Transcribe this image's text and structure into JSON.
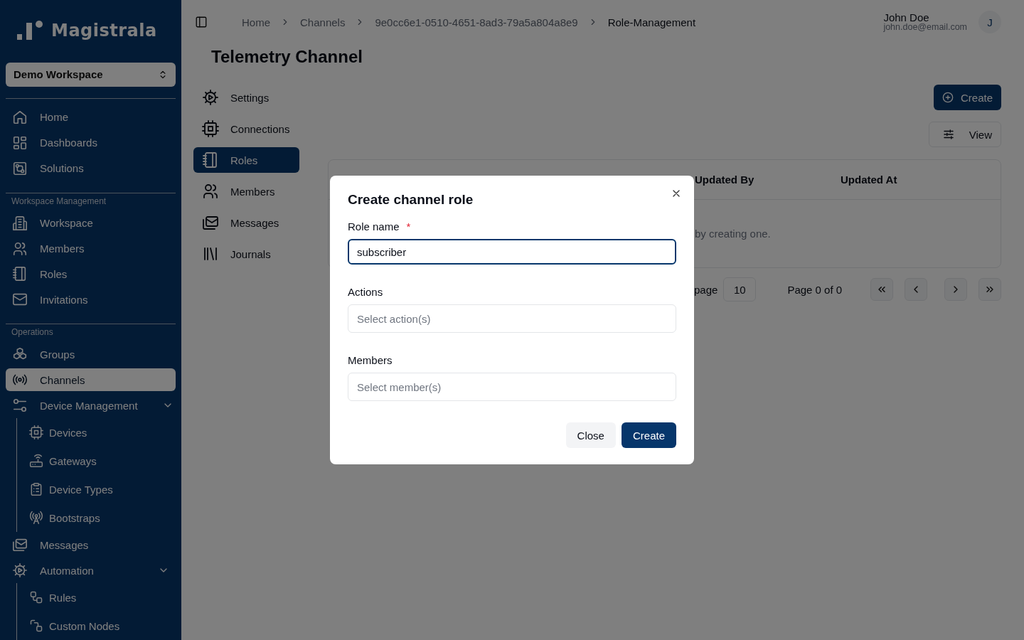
{
  "sidebar": {
    "logo": "Magistrala",
    "workspace": "Demo Workspace",
    "sections": [
      {
        "items": [
          {
            "label": "Home",
            "selected": false
          },
          {
            "label": "Dashboards",
            "selected": false
          },
          {
            "label": "Solutions",
            "selected": false
          }
        ]
      },
      {
        "heading": "Workspace Management",
        "items": [
          {
            "label": "Workspace",
            "selected": false
          },
          {
            "label": "Members",
            "selected": false
          },
          {
            "label": "Roles",
            "selected": false
          },
          {
            "label": "Invitations",
            "selected": false
          }
        ]
      },
      {
        "heading": "Operations",
        "items": [
          {
            "label": "Groups",
            "selected": false
          },
          {
            "label": "Channels",
            "selected": true
          },
          {
            "label": "Device Management",
            "selected": false,
            "expanded": true,
            "children": [
              {
                "label": "Devices",
                "selected": false
              },
              {
                "label": "Gateways",
                "selected": false
              },
              {
                "label": "Device Types",
                "selected": false
              },
              {
                "label": "Bootstraps",
                "selected": false
              }
            ]
          },
          {
            "label": "Messages",
            "selected": false
          },
          {
            "label": "Automation",
            "selected": false,
            "expanded": true,
            "children": [
              {
                "label": "Rules",
                "selected": false
              },
              {
                "label": "Custom Nodes",
                "selected": false
              }
            ]
          }
        ]
      }
    ]
  },
  "breadcrumbs": [
    "Home",
    "Channels",
    "9e0cc6e1-0510-4651-8ad3-79a5a804a8e9",
    "Role-Management"
  ],
  "user": {
    "name": "John Doe",
    "email": "john.doe@email.com",
    "initial": "J"
  },
  "page_title": "Telemetry Channel",
  "tabs": [
    {
      "label": "Settings",
      "selected": false
    },
    {
      "label": "Connections",
      "selected": false
    },
    {
      "label": "Roles",
      "selected": true
    },
    {
      "label": "Members",
      "selected": false
    },
    {
      "label": "Messages",
      "selected": false
    },
    {
      "label": "Journals",
      "selected": false
    }
  ],
  "toolbar": {
    "create": "Create",
    "view": "View"
  },
  "table": {
    "columns": [
      "Updated By",
      "Updated At"
    ],
    "empty_text": "by creating one."
  },
  "pagination": {
    "rows_label": "page",
    "rows_per_page": "10",
    "page_info": "Page 0 of 0"
  },
  "dialog": {
    "title": "Create channel role",
    "fields": [
      {
        "label": "Role name",
        "required_mark": "*",
        "value": "subscriber",
        "focused": true
      },
      {
        "label": "Actions",
        "placeholder": "Select action(s)",
        "focused": false
      },
      {
        "label": "Members",
        "placeholder": "Select member(s)",
        "focused": false
      }
    ],
    "buttons": [
      {
        "label": "Close",
        "kind": "secondary"
      },
      {
        "label": "Create",
        "kind": "primary"
      }
    ]
  }
}
